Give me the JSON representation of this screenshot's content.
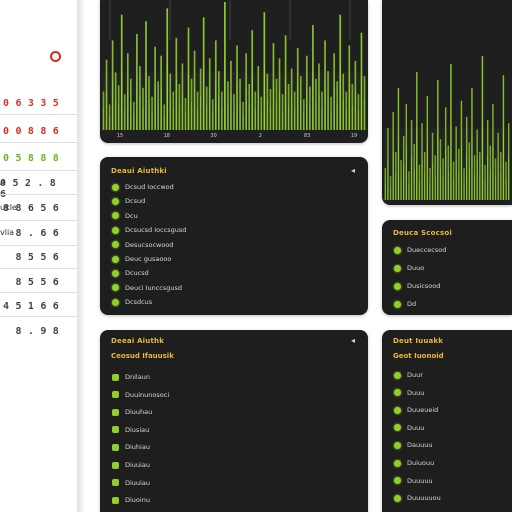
{
  "sidebar": {
    "rows": [
      {
        "tag": "",
        "value": "0",
        "color": "#d42a20"
      },
      {
        "tag": "",
        "value": "0 6 3 3 5",
        "color": "#c33a30"
      },
      {
        "tag": "",
        "value": "0 0 8 8 6",
        "color": "#d0321f"
      },
      {
        "tag": "",
        "value": "0 5 8 8 8",
        "color": "#6fb323"
      },
      {
        "tag": "A",
        "value": "0 5 2 . 8 6",
        "color": "#444444"
      },
      {
        "tag": "ukle",
        "value": "8 8 6 5 6",
        "color": "#444444"
      },
      {
        "tag": "vlia",
        "value": "8 . 6 6",
        "color": "#444444"
      },
      {
        "tag": "",
        "value": "8 5 5 6",
        "color": "#444444"
      },
      {
        "tag": "",
        "value": "8 5 5 6",
        "color": "#444444"
      },
      {
        "tag": "",
        "value": "4 5 1 6 6",
        "color": "#444444"
      },
      {
        "tag": "",
        "value": "8 . 9 8",
        "color": "#444444"
      }
    ]
  },
  "colors": {
    "accent": "#8fd12a",
    "title": "#e8b838",
    "panel": "#1e1e1e",
    "alert": "#d42a20"
  },
  "chart_main": {
    "tick_labels": [
      "15",
      "18",
      "30",
      "2",
      "83",
      "19"
    ],
    "top_axis": [
      "0",
      "0",
      "0",
      "0",
      "0"
    ]
  },
  "chart_data": [
    {
      "type": "bar",
      "title": "",
      "xlabel": "",
      "ylabel": "",
      "categories": [
        "15",
        "18",
        "30",
        "2",
        "83",
        "19"
      ],
      "ylim": [
        0,
        100
      ],
      "values": [
        30,
        55,
        20,
        70,
        45,
        35,
        90,
        28,
        60,
        40,
        22,
        75,
        50,
        33,
        85,
        42,
        26,
        65,
        38,
        58,
        20,
        95,
        44,
        30,
        72,
        36,
        52,
        25,
        80,
        40,
        62,
        30,
        48,
        88,
        34,
        56,
        24,
        70,
        46,
        30,
        100,
        38,
        54,
        28,
        66,
        40,
        22,
        60,
        36,
        78,
        30,
        50,
        26,
        92,
        44,
        32,
        68,
        40,
        56,
        28,
        74,
        36,
        48,
        30,
        64,
        42,
        24,
        58,
        34,
        82,
        40,
        52,
        30,
        70,
        46,
        26,
        60,
        38,
        90,
        44,
        30,
        66,
        36,
        54,
        28,
        76,
        42
      ]
    },
    {
      "type": "bar",
      "title": "",
      "xlabel": "",
      "ylabel": "",
      "categories": [],
      "ylim": [
        0,
        100
      ],
      "values": [
        20,
        45,
        15,
        55,
        30,
        70,
        25,
        40,
        60,
        18,
        50,
        35,
        80,
        22,
        48,
        30,
        65,
        20,
        42,
        28,
        75,
        38,
        26,
        58,
        34,
        85,
        24,
        46,
        32,
        62,
        20,
        52,
        36,
        70,
        28,
        44,
        30,
        90,
        22,
        50,
        34,
        60,
        26,
        42,
        30,
        78,
        24,
        48
      ]
    }
  ],
  "panels": {
    "top_left_list": {
      "title": "Deaui Aiuthki",
      "menu": "◂",
      "items": [
        "Dcsud Ioccwod",
        "Dcsud",
        "Dcu",
        "Dcsucsd Ioccsgusd",
        "Desucsocwood",
        "Deuc gusaooo",
        "Dcucsd",
        "Deuci Iunccsgusd",
        "Dcsdcus"
      ]
    },
    "mid_right_list": {
      "title": "Deuca Scocsoi",
      "items": [
        "Dueccecsod",
        "Duuo",
        "Dusicsood",
        "Dd"
      ]
    },
    "bottom_left_list": {
      "title": "Deeai Aiuthk",
      "subtitle": "Ceosud Ifauusik",
      "menu": "◂",
      "items": [
        "Dnilaun",
        "Duuinunosoci",
        "Diuuhau",
        "Diusiau",
        "Diuhiau",
        "Diuuiau",
        "Diuuiau",
        "Diuoinu",
        "Diuusuu"
      ]
    },
    "bottom_right_list": {
      "title": "Deut Iuuakk",
      "subtitle": "Geot Iuonoid",
      "items": [
        "Duur",
        "Duuu",
        "Duueueid",
        "Duuu",
        "Dauuuu",
        "Duiuouu",
        "Duuuuu",
        "Duuuuuou"
      ]
    }
  }
}
